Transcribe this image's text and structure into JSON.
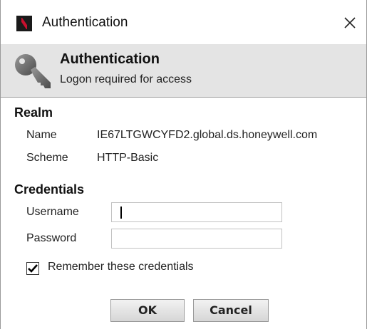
{
  "window": {
    "title": "Authentication",
    "close_glyph": "✕"
  },
  "banner": {
    "title": "Authentication",
    "subtitle": "Logon required for access",
    "icon": "key-icon"
  },
  "realm": {
    "heading": "Realm",
    "name_label": "Name",
    "name_value": "IE67LTGWCYFD2.global.ds.honeywell.com",
    "scheme_label": "Scheme",
    "scheme_value": "HTTP-Basic"
  },
  "credentials": {
    "heading": "Credentials",
    "username_label": "Username",
    "username_value": "",
    "password_label": "Password",
    "password_value": "",
    "remember_label": "Remember these credentials",
    "remember_checked": true
  },
  "buttons": {
    "ok_label": "OK",
    "cancel_label": "Cancel"
  },
  "colors": {
    "banner_bg": "#e4e4e4",
    "logo_red": "#c8102e"
  }
}
